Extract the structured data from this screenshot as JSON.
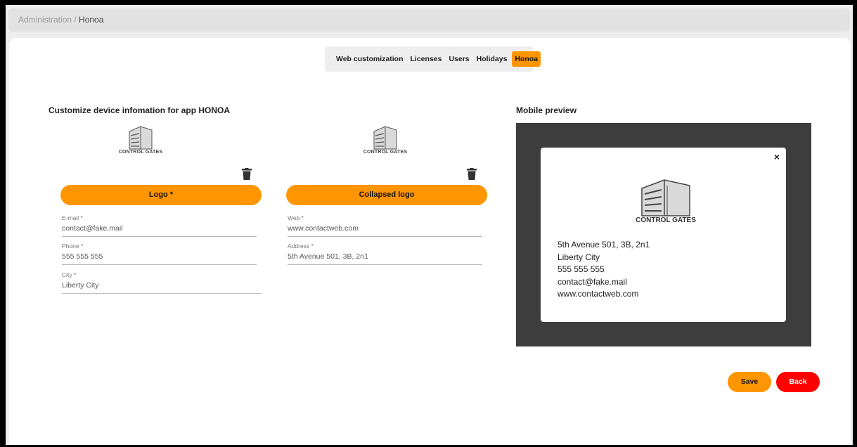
{
  "breadcrumb": {
    "parent": "Administration",
    "separator": " / ",
    "current": "Honoa"
  },
  "tabs": [
    {
      "label": "Web customization",
      "active": false
    },
    {
      "label": "Licenses",
      "active": false
    },
    {
      "label": "Users",
      "active": false
    },
    {
      "label": "Holidays",
      "active": false
    },
    {
      "label": "Honoa",
      "active": true
    }
  ],
  "form": {
    "title": "Customize device infomation for app HONOA",
    "logo": {
      "caption": "CONTROL GATES",
      "button_label": "Logo *"
    },
    "collapsed_logo": {
      "caption": "CONTROL GATES",
      "button_label": "Collapsed logo"
    },
    "fields": {
      "email": {
        "label": "E-mail *",
        "value": "contact@fake.mail"
      },
      "phone": {
        "label": "Phone *",
        "value": "555 555 555"
      },
      "city": {
        "label": "City *",
        "value": "Liberty City"
      },
      "web": {
        "label": "Web *",
        "value": "www.contactweb.com"
      },
      "address": {
        "label": "Address *",
        "value": "5th Avenue 501, 3B, 2n1"
      }
    }
  },
  "preview": {
    "title": "Mobile preview",
    "close": "×",
    "logo_caption": "CONTROL GATES",
    "lines": [
      "5th Avenue 501, 3B, 2n1",
      "Liberty City",
      "555 555 555",
      "contact@fake.mail",
      "www.contactweb.com"
    ]
  },
  "actions": {
    "save": "Save",
    "back": "Back"
  },
  "colors": {
    "accent": "#ff9500",
    "danger": "#ff0000",
    "preview_bg": "#3d3d3d"
  },
  "icons": {
    "logo": "building-icon",
    "delete": "trash-icon",
    "close": "close-icon"
  }
}
